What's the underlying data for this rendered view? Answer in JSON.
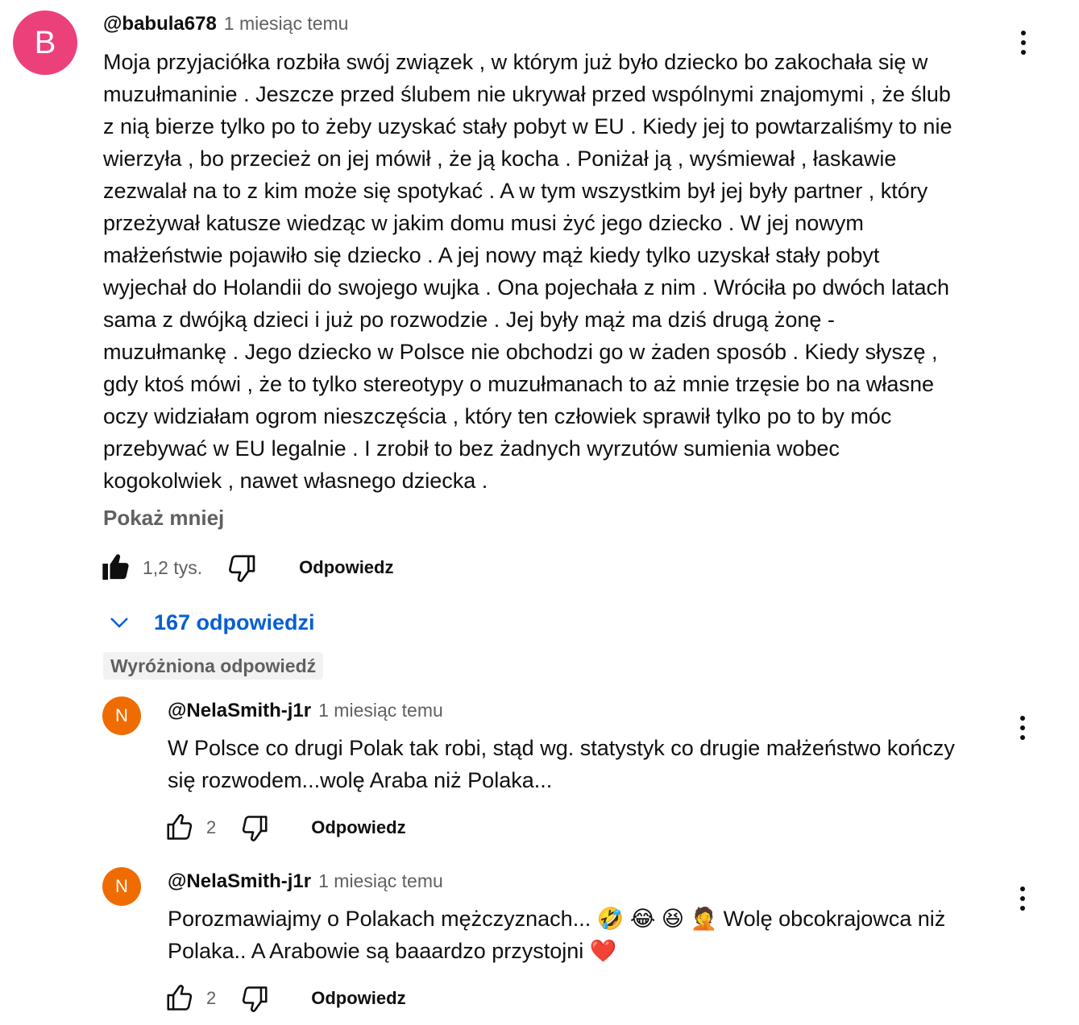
{
  "main_comment": {
    "avatar_letter": "B",
    "avatar_color": "#ec407a",
    "author": "@babula678",
    "time": "1 miesiąc temu",
    "lines": [
      "Moja przyjaciółka rozbiła swój związek , w którym już było dziecko bo zakochała się w",
      "muzułmaninie . Jeszcze przed ślubem nie ukrywał przed wspólnymi znajomymi , że ślub",
      "z nią bierze tylko po to żeby uzyskać stały pobyt w EU . Kiedy jej to powtarzaliśmy to nie",
      "wierzyła , bo przecież on jej mówił , że ją kocha . Poniżał ją , wyśmiewał , łaskawie",
      "zezwalał na to z kim może się spotykać . A w tym wszystkim był jej były partner , który",
      "przeżywał katusze wiedząc w jakim domu musi żyć jego dziecko . W jej nowym",
      "małżeństwie pojawiło się  dziecko . A jej nowy mąż kiedy tylko uzyskał stały pobyt",
      "wyjechał do Holandii do swojego wujka . Ona pojechała z nim . Wróciła po dwóch latach",
      "sama z dwójką dzieci i już po rozwodzie . Jej były mąż ma dziś drugą żonę -",
      "muzułmankę . Jego dziecko w Polsce nie obchodzi go w żaden sposób . Kiedy słyszę ,",
      "gdy ktoś mówi , że to tylko stereotypy o muzułmanach to aż mnie trzęsie bo na własne",
      "oczy widziałam ogrom nieszczęścia , który ten człowiek sprawił tylko po to by móc",
      "przebywać w EU legalnie . I zrobił to bez żadnych wyrzutów sumienia wobec",
      "kogokolwiek , nawet własnego dziecka ."
    ],
    "show_less": "Pokaż mniej",
    "likes": "1,2 tys.",
    "reply_label": "Odpowiedz",
    "like_icon": "thumbs-up-filled-icon",
    "dislike_icon": "thumbs-down-outline-icon"
  },
  "replies_toggle": {
    "label": "167 odpowiedzi",
    "icon": "chevron-down-icon",
    "color": "#065fd4"
  },
  "pinned_badge": "Wyróżniona odpowiedź",
  "replies": [
    {
      "avatar_letter": "N",
      "avatar_color": "#ef6c00",
      "author": "@NelaSmith-j1r",
      "time": "1 miesiąc temu",
      "lines": [
        "W Polsce co drugi Polak tak robi, stąd wg. statystyk co drugie małżeństwo kończy",
        "się rozwodem...wolę Araba niż Polaka..."
      ],
      "likes": "2",
      "reply_label": "Odpowiedz"
    },
    {
      "avatar_letter": "N",
      "avatar_color": "#ef6c00",
      "author": "@NelaSmith-j1r",
      "time": "1 miesiąc temu",
      "lines": [
        "Porozmawiajmy o Polakach mężczyznach... 🤣 😂 😆 🤦 Wolę obcokrajowca niż",
        "Polaka.. A Arabowie są baaardzo przystojni ❤️"
      ],
      "likes": "2",
      "reply_label": "Odpowiedz"
    }
  ]
}
